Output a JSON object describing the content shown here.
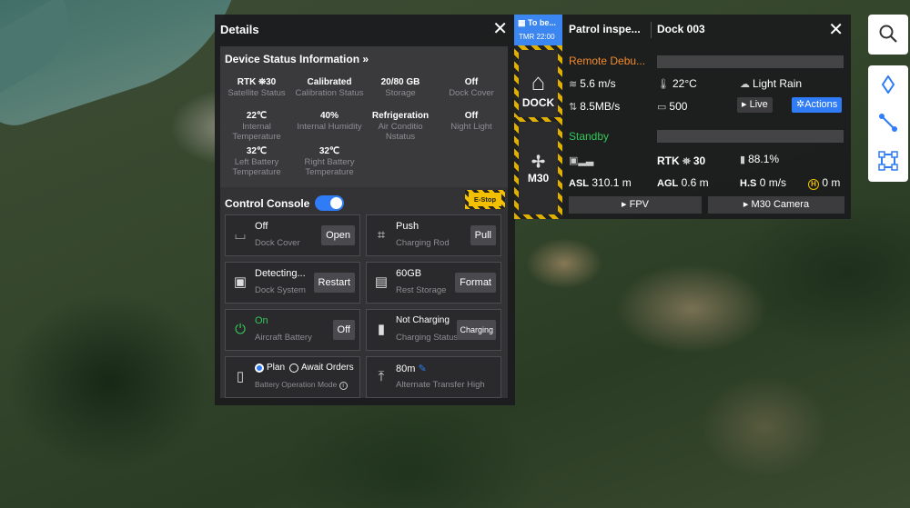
{
  "details": {
    "title": "Details",
    "device_status": {
      "title": "Device Status Information »",
      "items": [
        {
          "value": "RTK ⛯30",
          "label": "Satellite Status"
        },
        {
          "value": "Calibrated",
          "label": "Calibration Status"
        },
        {
          "value": "20/80 GB",
          "label": "Storage"
        },
        {
          "value": "Off",
          "label": "Dock Cover"
        },
        {
          "value": "22℃",
          "label": "Internal Temperature"
        },
        {
          "value": "40%",
          "label": "Internal Humidity"
        },
        {
          "value": "Refrigeration",
          "label": "Air Conditio Nstatus"
        },
        {
          "value": "Off",
          "label": "Night Light"
        },
        {
          "value": "32℃",
          "label": "Left Battery Temperature"
        },
        {
          "value": "32℃",
          "label": "Right Battery Temperature"
        }
      ]
    },
    "console": {
      "title": "Control Console",
      "estop": "E-Stop",
      "controls": [
        {
          "value": "Off",
          "label": "Dock Cover",
          "button": "Open",
          "icon": "dock-cover-icon"
        },
        {
          "value": "Push",
          "label": "Charging Rod",
          "button": "Pull",
          "icon": "charging-rod-icon"
        },
        {
          "value": "Detecting...",
          "label": "Dock System",
          "button": "Restart",
          "icon": "dock-system-icon"
        },
        {
          "value": "60GB",
          "label": "Rest Storage",
          "button": "Format",
          "icon": "storage-icon"
        },
        {
          "value": "On",
          "label": "Aircraft Battery",
          "button": "Off",
          "icon": "power-icon"
        },
        {
          "value": "Not Charging",
          "label": "Charging Status",
          "button": "Charging",
          "icon": "battery-icon"
        },
        {
          "value_plan": "Plan",
          "value_await": "Await Orders",
          "label": "Battery Operation Mode",
          "icon": "battery-mode-icon"
        },
        {
          "value": "80m",
          "label": "Alternate Transfer High",
          "icon": "altitude-icon"
        }
      ]
    }
  },
  "dock_panel": {
    "task_badge": {
      "title": "To be...",
      "time": "TMR 22:00"
    },
    "task_name": "Patrol inspe...",
    "dock_name": "Dock 003",
    "dock_label": "DOCK",
    "dock_status": "Remote Debu...",
    "dock_stats": {
      "wind": "5.6 m/s",
      "temp": "22°C",
      "weather": "Light Rain",
      "network": "8.5MB/s",
      "media": "500"
    },
    "live_button": "Live",
    "actions_button": "Actions",
    "drone_label": "M30",
    "drone_status": "Standby",
    "drone_stats": {
      "rtk": "RTK",
      "rtk_sats": "30",
      "battery": "88.1%",
      "asl_label": "ASL",
      "asl": "310.1 m",
      "agl_label": "AGL",
      "agl": "0.6 m",
      "hs_label": "H.S",
      "hs": "0 m/s",
      "h": "0 m"
    },
    "fpv_button": "FPV",
    "camera_button": "M30 Camera"
  },
  "colors": {
    "accent": "#2f7cf6",
    "warning": "#f28b2c",
    "ok": "#34c759",
    "hazard": "#e0b000"
  }
}
